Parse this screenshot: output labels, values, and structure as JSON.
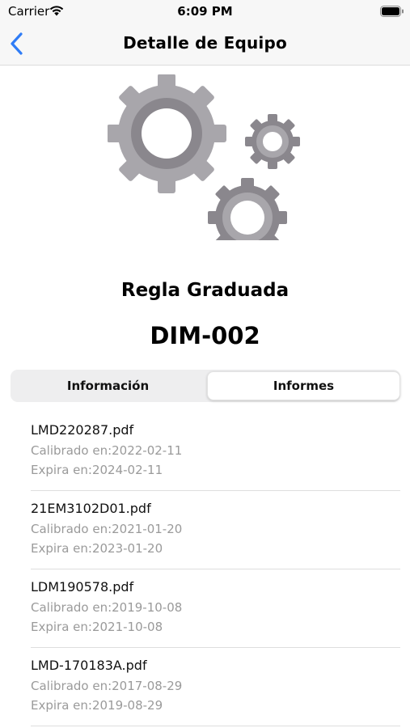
{
  "status_bar": {
    "carrier": "Carrier",
    "time": "6:09 PM"
  },
  "nav": {
    "title": "Detalle de Equipo",
    "back_icon": "chevron-left-icon"
  },
  "equipment": {
    "name": "Regla Graduada",
    "code": "DIM-002",
    "image_icon": "gears-icon"
  },
  "tabs": [
    {
      "label": "Información",
      "selected": false
    },
    {
      "label": "Informes",
      "selected": true
    }
  ],
  "reports": [
    {
      "file": "LMD220287.pdf",
      "calibrated": "Calibrado en:2022-02-11",
      "expires": "Expira en:2024-02-11"
    },
    {
      "file": "21EM3102D01.pdf",
      "calibrated": "Calibrado en:2021-01-20",
      "expires": "Expira en:2023-01-20"
    },
    {
      "file": "LDM190578.pdf",
      "calibrated": "Calibrado en:2019-10-08",
      "expires": "Expira en:2021-10-08"
    },
    {
      "file": "LMD-170183A.pdf",
      "calibrated": "Calibrado en:2017-08-29",
      "expires": "Expira en:2019-08-29"
    }
  ],
  "colors": {
    "accent": "#2f7cf6",
    "gear_light": "#a8a6ab",
    "gear_dark": "#8a878d",
    "muted_text": "#9a9a9a"
  }
}
